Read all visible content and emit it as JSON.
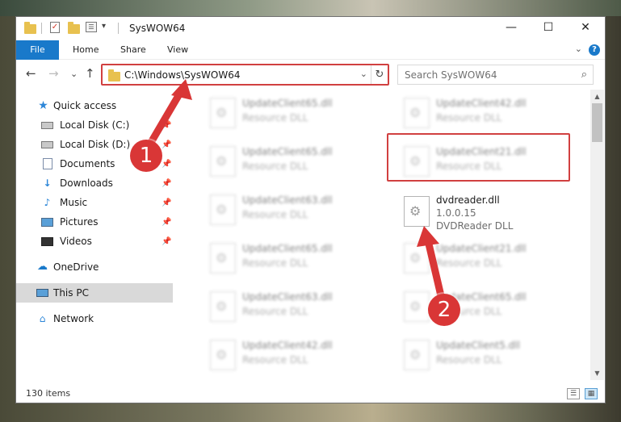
{
  "window": {
    "title": "SysWOW64",
    "minimize_glyph": "—",
    "maximize_glyph": "☐",
    "close_glyph": "✕"
  },
  "ribbon": {
    "tabs": [
      "File",
      "Home",
      "Share",
      "View"
    ],
    "help_glyph": "?",
    "collapse_glyph": "⌄"
  },
  "nav": {
    "back_glyph": "←",
    "forward_glyph": "→",
    "recent_glyph": "⌄",
    "up_glyph": "↑",
    "address": "C:\\Windows\\SysWOW64",
    "address_dropdown_glyph": "⌄",
    "refresh_glyph": "↻",
    "search_placeholder": "Search SysWOW64",
    "search_glyph": "⌕"
  },
  "sidebar": {
    "items": [
      {
        "label": "Quick access",
        "icon": "star-icon",
        "glyph": "★"
      },
      {
        "label": "Local Disk (C:)",
        "icon": "local-disk-icon",
        "glyph": "",
        "pinned": true
      },
      {
        "label": "Local Disk (D:)",
        "icon": "local-disk-icon",
        "glyph": "",
        "pinned": true
      },
      {
        "label": "Documents",
        "icon": "documents-icon",
        "glyph": "",
        "pinned": true
      },
      {
        "label": "Downloads",
        "icon": "downloads-icon",
        "glyph": "↓",
        "pinned": true
      },
      {
        "label": "Music",
        "icon": "music-icon",
        "glyph": "♪",
        "pinned": true
      },
      {
        "label": "Pictures",
        "icon": "pictures-icon",
        "glyph": "",
        "pinned": true
      },
      {
        "label": "Videos",
        "icon": "videos-icon",
        "glyph": "",
        "pinned": true
      },
      {
        "label": "OneDrive",
        "icon": "cloud-icon",
        "glyph": "☁"
      },
      {
        "label": "This PC",
        "icon": "computer-icon",
        "glyph": "",
        "selected": true
      },
      {
        "label": "Network",
        "icon": "network-icon",
        "glyph": "⌂"
      }
    ],
    "pin_glyph": "📌"
  },
  "files": {
    "left_column": [
      {
        "name": "UpdateClient65.dll",
        "type": "Resource DLL"
      },
      {
        "name": "UpdateClient65.dll",
        "type": "Resource DLL"
      },
      {
        "name": "UpdateClient63.dll",
        "type": "Resource DLL"
      },
      {
        "name": "UpdateClient65.dll",
        "type": "Resource DLL"
      },
      {
        "name": "UpdateClient63.dll",
        "type": "Resource DLL"
      },
      {
        "name": "UpdateClient42.dll",
        "type": "Resource DLL"
      }
    ],
    "right_column": [
      {
        "name": "UpdateClient42.dll",
        "type": "Resource DLL"
      },
      {
        "name": "UpdateClient21.dll",
        "type": "Resource DLL"
      },
      {
        "name": "UpdateClient21.dll",
        "type": "Resource DLL"
      },
      {
        "name": "UpdateClient65.dll",
        "type": "Resource DLL"
      },
      {
        "name": "UpdateClient5.dll",
        "type": "Resource DLL"
      }
    ],
    "highlighted": {
      "name": "dvdreader.dll",
      "version": "1.0.0.15",
      "type": "DVDReader DLL"
    }
  },
  "status": {
    "item_count": "130 items"
  },
  "annotations": {
    "step1": "1",
    "step2": "2",
    "color": "#d93636"
  }
}
